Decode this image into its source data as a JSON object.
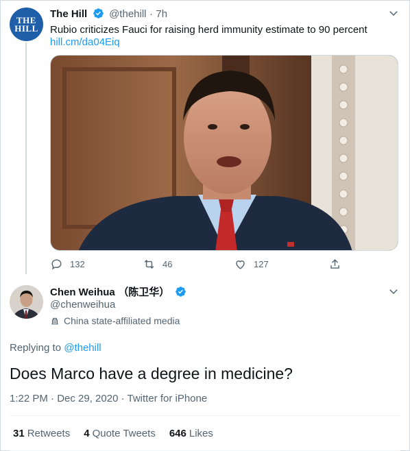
{
  "tweet_quoted": {
    "avatar_text": [
      "THE",
      "HILL"
    ],
    "name": "The Hill",
    "handle": "@thehill",
    "time": "7h",
    "dot": "·",
    "text": "Rubio criticizes Fauci for raising herd immunity estimate to 90 percent",
    "link": "hill.cm/da04Eiq",
    "replies": "132",
    "retweets": "46",
    "likes": "127"
  },
  "tweet_main": {
    "name": "Chen Weihua",
    "name_cjk": "（陈卫华）",
    "handle": "@chenweihua",
    "affiliation": "China state-affiliated media",
    "replying_prefix": "Replying to",
    "replying_handle": "@thehill",
    "text": "Does Marco have a degree in medicine?",
    "meta": "1:22 PM · Dec 29, 2020 · Twitter for iPhone",
    "stats": {
      "retweets_count": "31",
      "retweets_label": "Retweets",
      "quote_count": "4",
      "quote_label": "Quote Tweets",
      "likes_count": "646",
      "likes_label": "Likes"
    }
  },
  "colors": {
    "accent": "#1d9bf0",
    "muted": "#536471",
    "text": "#0f1419",
    "hill_blue": "#1f5ea8"
  },
  "icons": [
    "verified-badge-icon",
    "chevron-down-icon",
    "reply-icon",
    "retweet-icon",
    "like-icon",
    "share-icon",
    "building-icon"
  ]
}
